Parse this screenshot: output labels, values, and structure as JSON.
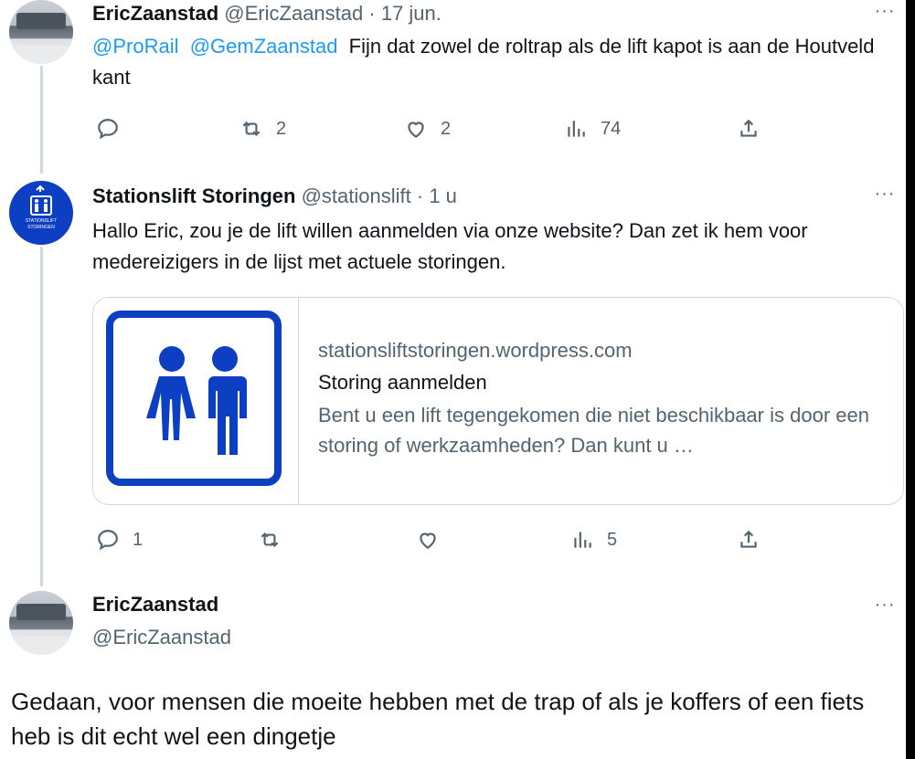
{
  "tweets": [
    {
      "name": "EricZaanstad",
      "handle": "@EricZaanstad",
      "sep": "·",
      "time": "17 jun.",
      "mention1": "@ProRail",
      "mention2": "@GemZaanstad",
      "text": "Fijn dat zowel de roltrap als de lift kapot is aan de Houtveld kant",
      "replies": "",
      "retweets": "2",
      "likes": "2",
      "views": "74"
    },
    {
      "name": "Stationslift Storingen",
      "handle": "@stationslift",
      "sep": "·",
      "time": "1 u",
      "text": "Hallo Eric, zou je de lift willen aanmelden via onze website? Dan zet ik hem voor medereizigers in de lijst met actuele storingen.",
      "replies": "1",
      "retweets": "",
      "likes": "",
      "views": "5",
      "card": {
        "domain": "stationsliftstoringen.wordpress.com",
        "title": "Storing aanmelden",
        "description": "Bent u een lift tegengekomen die niet beschikbaar is door een storing of werkzaamheden? Dan kunt u …"
      },
      "avatar_text_top": "STATIONSLIFT",
      "avatar_text_bottom": "STORINGEN"
    },
    {
      "name": "EricZaanstad",
      "handle": "@EricZaanstad",
      "text": "Gedaan, voor mensen die moeite hebben met de trap of als je koffers of een  fiets heb is dit echt wel een dingetje"
    }
  ],
  "more_label": "···",
  "colors": {
    "accent": "#1d9bf0",
    "muted": "#536471",
    "brand_blue": "#0d3fc2"
  },
  "icons": [
    "reply-icon",
    "retweet-icon",
    "like-icon",
    "views-icon",
    "share-icon",
    "more-icon"
  ]
}
